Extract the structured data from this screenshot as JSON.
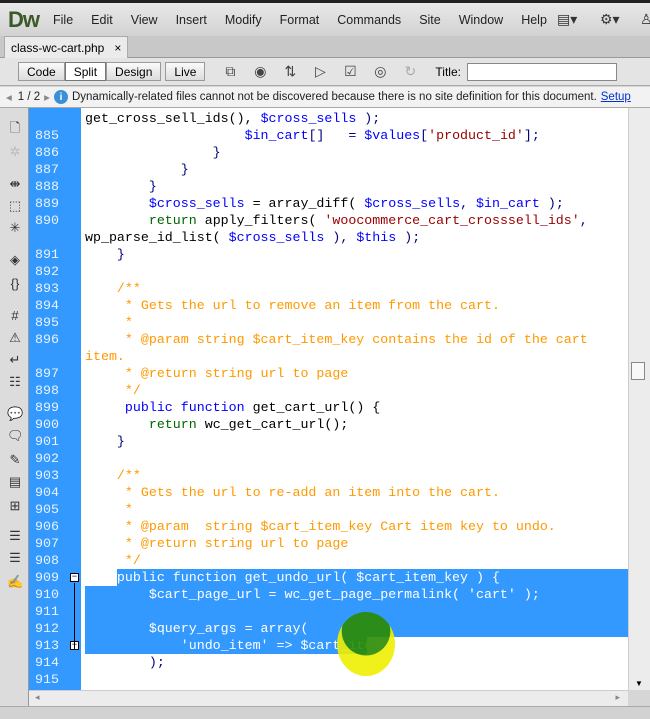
{
  "app": {
    "logo": "Dw"
  },
  "menu": [
    "File",
    "Edit",
    "View",
    "Insert",
    "Modify",
    "Format",
    "Commands",
    "Site",
    "Window",
    "Help"
  ],
  "tab": {
    "label": "class-wc-cart.php",
    "close": "×"
  },
  "toolbar": {
    "views": [
      "Code",
      "Split",
      "Design",
      "Live"
    ],
    "active": "Split",
    "title_label": "Title:",
    "title_value": ""
  },
  "infobar": {
    "page": "1 / 2",
    "message": "Dynamically-related files cannot not be discovered because there is no site definition for this document.",
    "link": "Setup"
  },
  "code": [
    {
      "n": "",
      "t": [
        [
          "get_cross_sell_ids(), ",
          "fn"
        ],
        [
          "$cross_sells",
          "var"
        ],
        [
          " );",
          "p"
        ]
      ]
    },
    {
      "n": "885",
      "t": [
        [
          "                    ",
          "p"
        ],
        [
          "$in_cart",
          "var"
        ],
        [
          "[]   = ",
          "p"
        ],
        [
          "$values",
          "var"
        ],
        [
          "[",
          "p"
        ],
        [
          "'product_id'",
          "str"
        ],
        [
          "];",
          "p"
        ]
      ]
    },
    {
      "n": "886",
      "t": [
        [
          "                }",
          "p"
        ]
      ]
    },
    {
      "n": "887",
      "t": [
        [
          "            }",
          "p"
        ]
      ]
    },
    {
      "n": "888",
      "t": [
        [
          "        }",
          "p"
        ]
      ]
    },
    {
      "n": "889",
      "t": [
        [
          "        ",
          "p"
        ],
        [
          "$cross_sells",
          "var"
        ],
        [
          " = array_diff( ",
          "fn"
        ],
        [
          "$cross_sells",
          "var"
        ],
        [
          ", ",
          "p"
        ],
        [
          "$in_cart",
          "var"
        ],
        [
          " );",
          "p"
        ]
      ]
    },
    {
      "n": "890",
      "t": [
        [
          "        ",
          "p"
        ],
        [
          "return",
          "ret"
        ],
        [
          " apply_filters( ",
          "fn"
        ],
        [
          "'woocommerce_cart_crosssell_ids'",
          "str"
        ],
        [
          ",",
          "p"
        ]
      ]
    },
    {
      "n": "",
      "t": [
        [
          "wp_parse_id_list( ",
          "fn"
        ],
        [
          "$cross_sells",
          "var"
        ],
        [
          " ), ",
          "p"
        ],
        [
          "$this",
          "var"
        ],
        [
          " );",
          "p"
        ]
      ]
    },
    {
      "n": "891",
      "t": [
        [
          "    }",
          "p"
        ]
      ]
    },
    {
      "n": "892",
      "t": []
    },
    {
      "n": "893",
      "t": [
        [
          "    /**",
          "com"
        ]
      ]
    },
    {
      "n": "894",
      "t": [
        [
          "     * Gets the url to remove an item from the cart.",
          "com"
        ]
      ]
    },
    {
      "n": "895",
      "t": [
        [
          "     *",
          "com"
        ]
      ]
    },
    {
      "n": "896",
      "t": [
        [
          "     * @param string $cart_item_key contains the id of the cart",
          "com"
        ]
      ]
    },
    {
      "n": "",
      "t": [
        [
          "item.",
          "com"
        ]
      ]
    },
    {
      "n": "897",
      "t": [
        [
          "     * @return string url to page",
          "com"
        ]
      ]
    },
    {
      "n": "898",
      "t": [
        [
          "     */",
          "com"
        ]
      ]
    },
    {
      "n": "899",
      "t": [
        [
          "     ",
          "p"
        ],
        [
          "public function",
          "kw"
        ],
        [
          " get_cart_url() {",
          "fn"
        ]
      ]
    },
    {
      "n": "900",
      "t": [
        [
          "        ",
          "p"
        ],
        [
          "return",
          "ret"
        ],
        [
          " wc_get_cart_url();",
          "fn"
        ]
      ]
    },
    {
      "n": "901",
      "t": [
        [
          "    }",
          "p"
        ]
      ]
    },
    {
      "n": "902",
      "t": []
    },
    {
      "n": "903",
      "t": [
        [
          "    /**",
          "com"
        ]
      ]
    },
    {
      "n": "904",
      "t": [
        [
          "     * Gets the url to re-add an item into the cart.",
          "com"
        ]
      ]
    },
    {
      "n": "905",
      "t": [
        [
          "     *",
          "com"
        ]
      ]
    },
    {
      "n": "906",
      "t": [
        [
          "     * @param  string $cart_item_key Cart item key to undo.",
          "com"
        ]
      ]
    },
    {
      "n": "907",
      "t": [
        [
          "     * @return string url to page",
          "com"
        ]
      ]
    },
    {
      "n": "908",
      "t": [
        [
          "     */",
          "com"
        ]
      ]
    },
    {
      "n": "909",
      "t": [
        [
          "    public function get_undo_url( $cart_item_key ) {",
          "p"
        ]
      ]
    },
    {
      "n": "910",
      "t": [
        [
          "        $cart_page_url = wc_get_page_permalink( 'cart' );",
          "p"
        ]
      ]
    },
    {
      "n": "911",
      "t": []
    },
    {
      "n": "912",
      "t": [
        [
          "        $query_args = array(",
          "p"
        ]
      ]
    },
    {
      "n": "913",
      "t": [
        [
          "            'undo_item' => $cart_item_key,",
          "p"
        ]
      ]
    },
    {
      "n": "914",
      "t": [
        [
          "        );",
          "p"
        ]
      ]
    },
    {
      "n": "915",
      "t": []
    }
  ]
}
